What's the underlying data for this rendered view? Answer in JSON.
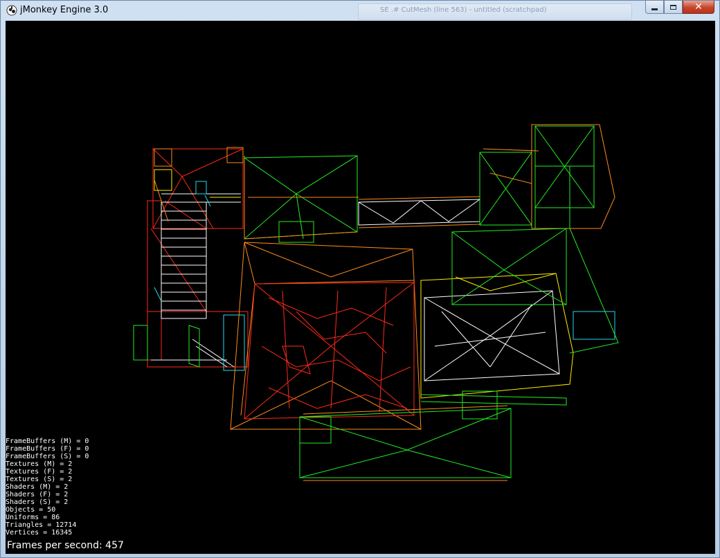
{
  "window": {
    "title": "jMonkey Engine 3.0",
    "background_tab_text": "SE .#  CutMesh (line 563) - untitled (scratchpad)",
    "controls": {
      "minimize_icon": "minimize-icon",
      "maximize_icon": "maximize-icon",
      "close_icon": "close-icon",
      "close_glyph": "✕"
    }
  },
  "stats": [
    "FrameBuffers (M) = 0",
    "FrameBuffers (F) = 0",
    "FrameBuffers (S) = 0",
    "Textures (M) = 2",
    "Textures (F) = 2",
    "Textures (S) = 2",
    "Shaders (M) = 2",
    "Shaders (F) = 2",
    "Shaders (S) = 2",
    "Objects = 50",
    "Uniforms = 86",
    "Triangles = 12714",
    "Vertices = 16345"
  ],
  "fps": "Frames per second: 457",
  "colors": {
    "viewport_bg": "#000000",
    "text": "#ffffff",
    "wire_red": "#ff2a1a",
    "wire_orange": "#ff8c1a",
    "wire_green": "#22ee22",
    "wire_yellow": "#ffee00",
    "wire_white": "#ffffff",
    "wire_cyan": "#22ddee"
  }
}
